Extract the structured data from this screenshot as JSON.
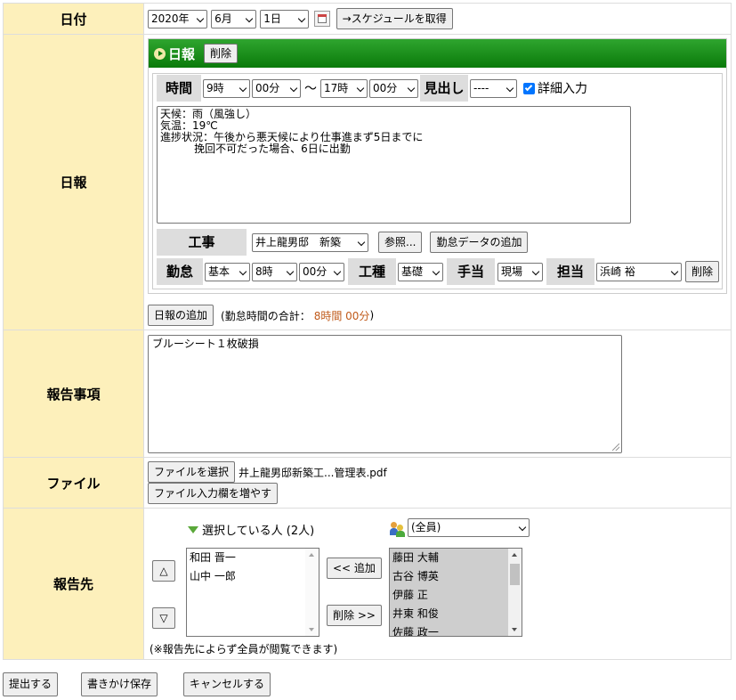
{
  "date": {
    "label": "日付",
    "year": "2020年",
    "month": "6月",
    "day": "1日",
    "schedule_button": "→スケジュールを取得"
  },
  "nippo": {
    "label": "日報",
    "header_title": "日報",
    "delete_button": "削除",
    "time_label": "時間",
    "start_hour": "9時",
    "start_min": "00分",
    "tilde": "～",
    "end_hour": "17時",
    "end_min": "00分",
    "heading_label": "見出し",
    "heading_value": "----",
    "detail_checkbox_label": "詳細入力",
    "content_text": "天候：雨（風強し）\n気温：19℃\n進捗状況：午後から悪天候により仕事進まず5日までに\n          挽回不可だった場合、6日に出勤",
    "project_label": "工事",
    "project_value": "井上龍男邸　新築",
    "browse_button": "参照...",
    "add_attendance_button": "勤怠データの追加",
    "attendance_label": "勤怠",
    "attendance_type": "基本",
    "attendance_hour": "8時",
    "attendance_min": "00分",
    "work_type_label": "工種",
    "work_type_value": "基礎",
    "allowance_label": "手当",
    "allowance_value": "現場",
    "person_label": "担当",
    "person_value": "浜崎 裕",
    "row_delete_button": "削除",
    "add_nippo_button": "日報の追加",
    "total_prefix": "(勤怠時間の合計：",
    "total_value": "8時間 00分",
    "total_suffix": ")"
  },
  "report": {
    "label": "報告事項",
    "text": "ブルーシート１枚破損"
  },
  "file": {
    "label": "ファイル",
    "choose_button": "ファイルを選択",
    "file_name": "井上龍男邸新築工...管理表.pdf",
    "add_field_button": "ファイル入力欄を増やす"
  },
  "recipients": {
    "label": "報告先",
    "selected_title": "選択している人 (2人)",
    "group_value": "(全員)",
    "selected": [
      "和田 晋一",
      "山中 一郎"
    ],
    "up_button": "△",
    "down_button": "▽",
    "add_button": "<< 追加",
    "remove_button": "削除 >>",
    "candidates": [
      "藤田 大輔",
      "古谷 博英",
      "伊藤 正",
      "井東 和俊",
      "佐藤 政一"
    ],
    "note": "(※報告先によらず全員が閲覧できます)"
  },
  "actions": {
    "submit": "提出する",
    "save_draft": "書きかけ保存",
    "cancel": "キャンセルする"
  },
  "colors": {
    "header_bg": "#fdf0bb",
    "nippo_bar": "#0a7a0a",
    "total_value": "#c05a1a",
    "listbox_selected_bg": "#cecece"
  }
}
